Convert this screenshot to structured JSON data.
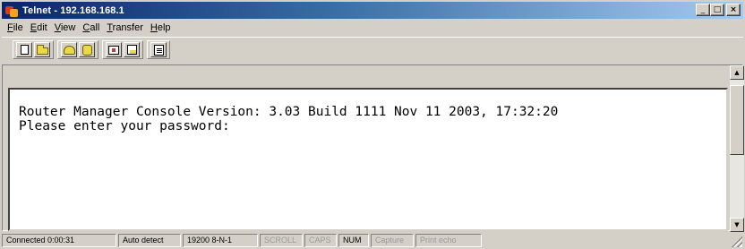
{
  "window": {
    "title": "Telnet - 192.168.168.1",
    "controls": {
      "minimize": "_",
      "maximize": "□",
      "close": "×"
    }
  },
  "menu": {
    "items": [
      {
        "label": "File",
        "hotkey": "F",
        "rest": "ile"
      },
      {
        "label": "Edit",
        "hotkey": "E",
        "rest": "dit"
      },
      {
        "label": "View",
        "hotkey": "V",
        "rest": "iew"
      },
      {
        "label": "Call",
        "hotkey": "C",
        "rest": "all"
      },
      {
        "label": "Transfer",
        "hotkey": "T",
        "rest": "ransfer"
      },
      {
        "label": "Help",
        "hotkey": "H",
        "rest": "elp"
      }
    ]
  },
  "toolbar": {
    "icons": [
      "new-document-icon",
      "open-folder-icon",
      "connect-phone-icon",
      "disconnect-icon",
      "send-file-icon",
      "receive-file-icon",
      "properties-icon"
    ]
  },
  "terminal": {
    "lines": [
      "Router Manager Console Version: 3.03 Build 1111 Nov 11 2003, 17:32:20",
      "Please enter your password:"
    ]
  },
  "status": {
    "connected": "Connected 0:00:31",
    "detect": "Auto detect",
    "port": "19200 8-N-1",
    "scroll": "SCROLL",
    "caps": "CAPS",
    "num": "NUM",
    "capture": "Capture",
    "print_echo": "Print echo"
  }
}
